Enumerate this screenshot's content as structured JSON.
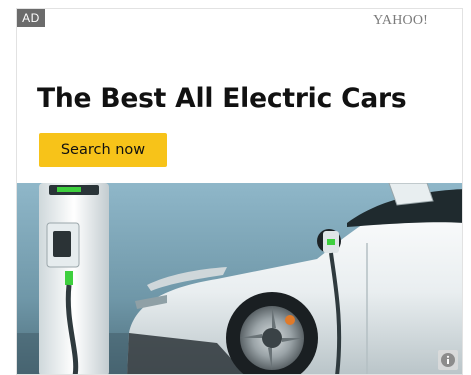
{
  "ad": {
    "badge": "AD",
    "brand": "YAHOO!",
    "headline": "The Best All Electric Cars",
    "cta_label": "Search now",
    "image_subject": "white electric car charging at a charging station"
  },
  "colors": {
    "cta_background": "#f7c319",
    "badge_background": "#6b6b6b",
    "headline_text": "#111111",
    "charger_plug_accent": "#3ecf3e"
  },
  "icons": {
    "info": "info-icon"
  }
}
